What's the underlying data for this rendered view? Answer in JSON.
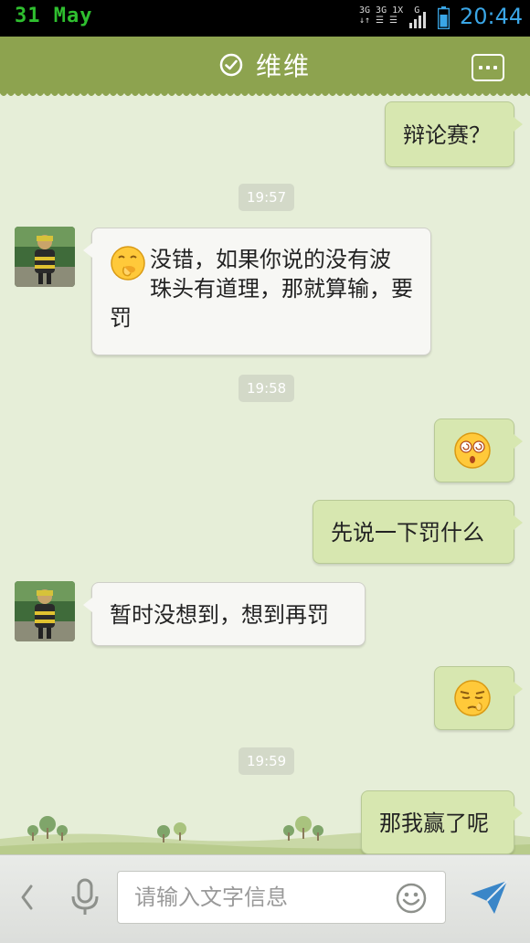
{
  "status_bar": {
    "date": "31 May",
    "network_line1": "3G 3G 1X  G",
    "network_line2": "↓↑ ☰ ☰",
    "time": "20:44",
    "date_color": "#2fbf2f",
    "time_color": "#3aa6e6"
  },
  "header": {
    "title": "维维",
    "verified_icon": "check-circle-icon",
    "menu_icon": "more-dots-icon",
    "bar_color": "#8da34f"
  },
  "messages": [
    {
      "type": "out",
      "text": "辩论赛？"
    },
    {
      "type": "time",
      "text": "19:57"
    },
    {
      "type": "in",
      "emoji": "shush-emoji",
      "lines": [
        "没错，如果你说的没有波",
        "珠头有道理，那就算输，要",
        "罚"
      ]
    },
    {
      "type": "time",
      "text": "19:58"
    },
    {
      "type": "out",
      "emoji": "dizzy-face-emoji"
    },
    {
      "type": "out",
      "text": "先说一下罚什么"
    },
    {
      "type": "in",
      "text": "暂时没想到，想到再罚"
    },
    {
      "type": "out",
      "emoji": "snooty-face-emoji"
    },
    {
      "type": "time",
      "text": "19:59"
    },
    {
      "type": "out",
      "text": "那我赢了呢"
    }
  ],
  "input_bar": {
    "placeholder": "请输入文字信息",
    "value": "",
    "icons": [
      "chevron-left-icon",
      "microphone-icon",
      "smiley-icon",
      "send-icon"
    ]
  },
  "colors": {
    "chat_background": "#e6eed8",
    "outgoing_bubble": "#d7e7b0",
    "incoming_bubble": "#f7f7f4",
    "time_chip": "#d3d9c8",
    "send_icon": "#3a86c8"
  }
}
